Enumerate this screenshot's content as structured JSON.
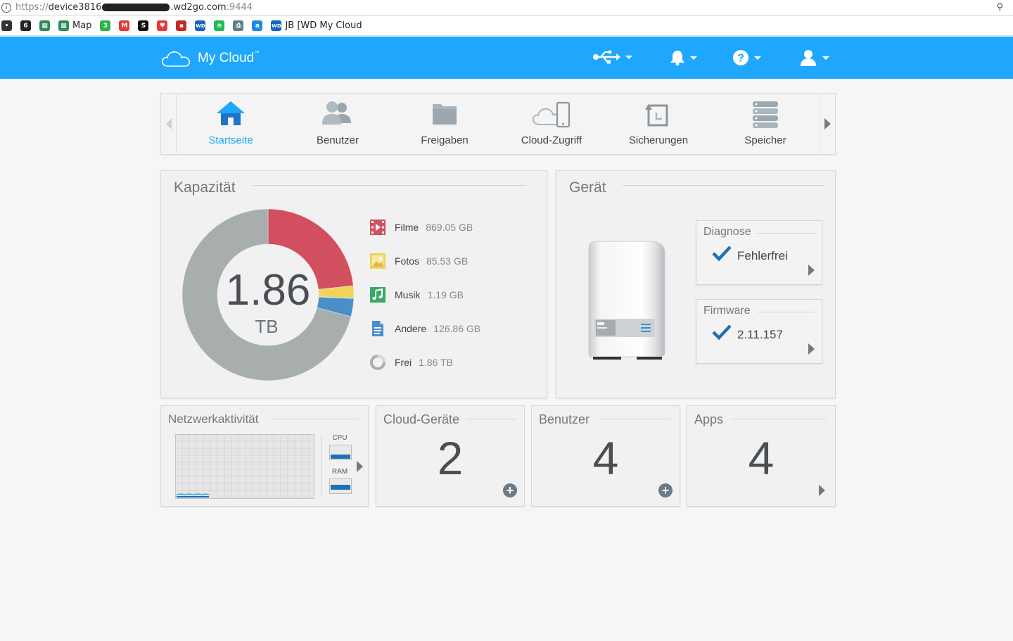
{
  "browser": {
    "url_scheme": "https://",
    "url_host_start": "device3816",
    "url_host_end": ".wd2go.com",
    "url_port": ":9444",
    "bookmarks": [
      {
        "icon": "bookmark-generic-icon",
        "label": "",
        "color": "#333333"
      },
      {
        "icon": "bookmark-6-icon",
        "label": "",
        "color": "#222222"
      },
      {
        "icon": "bookmark-map-icon",
        "label": "",
        "color": "#2e8b57"
      },
      {
        "icon": "bookmark-map-icon",
        "label": "Map",
        "color": "#2e8b57"
      },
      {
        "icon": "bookmark-3-icon",
        "label": "",
        "color": "#2fb24a"
      },
      {
        "icon": "bookmark-gmail-icon",
        "label": "",
        "color": "#e53935"
      },
      {
        "icon": "bookmark-s-icon",
        "label": "",
        "color": "#111111"
      },
      {
        "icon": "bookmark-heart-icon",
        "label": "",
        "color": "#e53935"
      },
      {
        "icon": "bookmark-red-icon",
        "label": "",
        "color": "#c62828"
      },
      {
        "icon": "bookmark-wd-icon",
        "label": "",
        "color": "#1565c0"
      },
      {
        "icon": "bookmark-spotify-icon",
        "label": "",
        "color": "#1db954"
      },
      {
        "icon": "bookmark-printer-icon",
        "label": "",
        "color": "#607d8b"
      },
      {
        "icon": "bookmark-amazon-icon",
        "label": "",
        "color": "#1e88e5"
      },
      {
        "icon": "bookmark-wd-icon",
        "label": "JB [WD My Cloud",
        "color": "#1565c0"
      }
    ]
  },
  "header": {
    "brand": "My Cloud",
    "trademark": "™",
    "accent": "#1ea7fd",
    "icons": [
      "usb-icon",
      "bell-icon",
      "help-icon",
      "user-icon"
    ]
  },
  "nav": {
    "items": [
      {
        "label": "Startseite",
        "icon": "home-icon",
        "active": true
      },
      {
        "label": "Benutzer",
        "icon": "users-icon",
        "active": false
      },
      {
        "label": "Freigaben",
        "icon": "folder-icon",
        "active": false
      },
      {
        "label": "Cloud-Zugriff",
        "icon": "cloud-access-icon",
        "active": false
      },
      {
        "label": "Sicherungen",
        "icon": "backup-icon",
        "active": false
      },
      {
        "label": "Speicher",
        "icon": "storage-icon",
        "active": false
      }
    ]
  },
  "capacity": {
    "title": "Kapazität",
    "total_value": "1.86",
    "total_unit": "TB",
    "categories": [
      {
        "name": "Filme",
        "size": "869.05 GB",
        "color": "#d14f5e",
        "icon": "film-icon"
      },
      {
        "name": "Fotos",
        "size": "85.53 GB",
        "color": "#f0d35a",
        "icon": "photo-icon"
      },
      {
        "name": "Musik",
        "size": "1.19 GB",
        "color": "#3aa966",
        "icon": "music-icon"
      },
      {
        "name": "Andere",
        "size": "126.86 GB",
        "color": "#4a90c8",
        "icon": "document-icon"
      },
      {
        "name": "Frei",
        "size": "1.86 TB",
        "color": "#a8adad",
        "icon": "free-space-icon"
      }
    ],
    "donut_fractions": {
      "filme": 0.233,
      "fotos": 0.023,
      "musik": 0.001,
      "andere": 0.034,
      "frei": 0.709
    }
  },
  "device": {
    "title": "Gerät",
    "diagnose": {
      "title": "Diagnose",
      "status": "Fehlerfrei"
    },
    "firmware": {
      "title": "Firmware",
      "version": "2.11.157"
    }
  },
  "network": {
    "title": "Netzwerkaktivität",
    "cpu_label": "CPU",
    "ram_label": "RAM"
  },
  "cloud_devices": {
    "title": "Cloud-Geräte",
    "count": "2"
  },
  "users": {
    "title": "Benutzer",
    "count": "4"
  },
  "apps": {
    "title": "Apps",
    "count": "4"
  }
}
